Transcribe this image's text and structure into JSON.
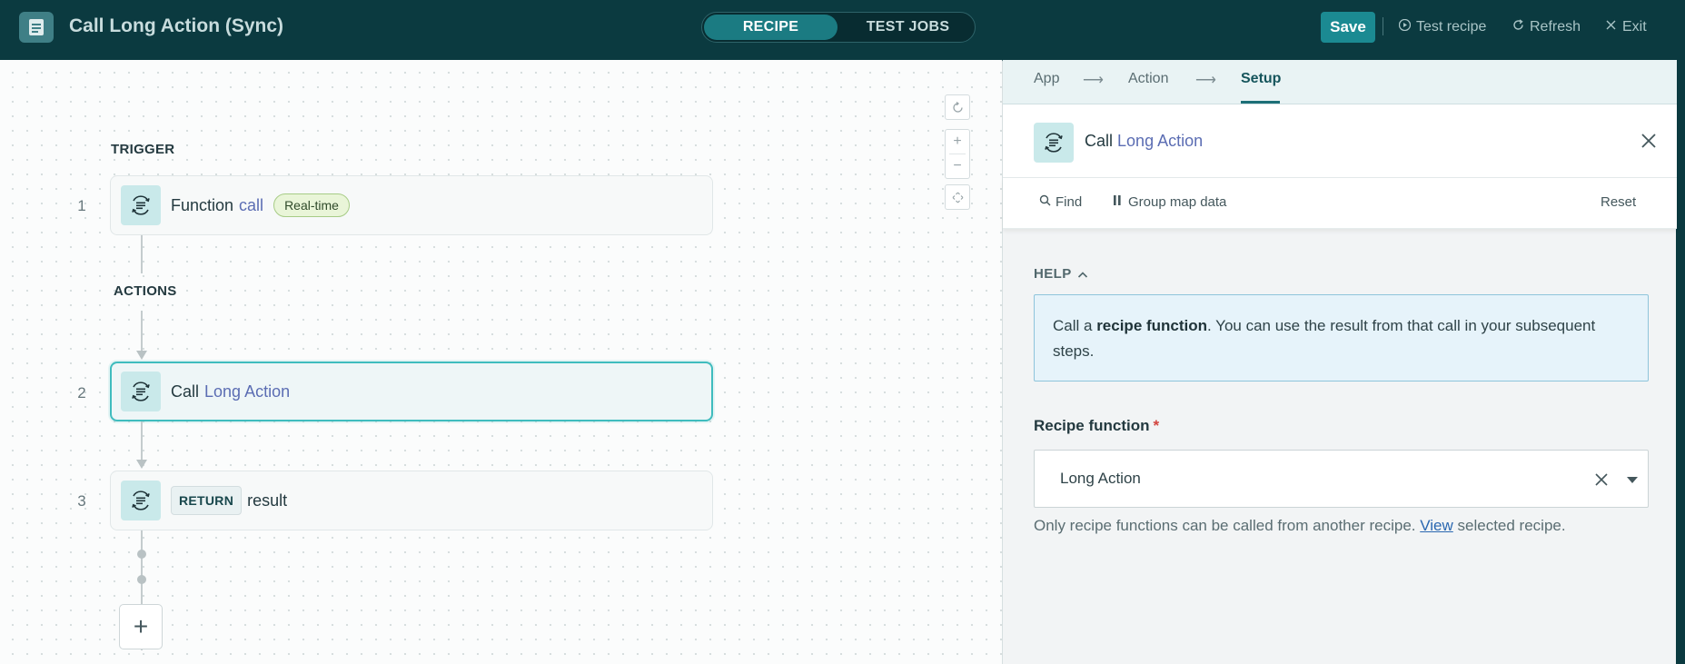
{
  "header": {
    "title": "Call Long Action (Sync)",
    "tabs": [
      "RECIPE",
      "TEST JOBS"
    ],
    "save_label": "Save",
    "test_recipe_label": "Test recipe",
    "refresh_label": "Refresh",
    "exit_label": "Exit"
  },
  "canvas": {
    "trigger_label": "TRIGGER",
    "actions_label": "ACTIONS",
    "steps": [
      {
        "number": "1",
        "text_plain": "Function",
        "text_highlight": "call",
        "badge": "Real-time"
      },
      {
        "number": "2",
        "text_plain": "Call",
        "text_highlight": "Long Action"
      },
      {
        "number": "3",
        "keyword": "RETURN",
        "text_plain": "result"
      }
    ],
    "add_step_symbol": "+"
  },
  "panel": {
    "breadcrumbs": [
      "App",
      "Action",
      "Setup"
    ],
    "breadcrumb_separator": "⟶",
    "step_title_plain": "Call",
    "step_title_highlight": "Long Action",
    "toolbar": {
      "find_label": "Find",
      "group_map_label": "Group map data",
      "reset_label": "Reset"
    },
    "help": {
      "header": "HELP",
      "text_before": "Call a ",
      "text_bold": "recipe function",
      "text_after": ". You can use the result from that call in your subsequent steps."
    },
    "field": {
      "label": "Recipe function",
      "required_mark": "*",
      "value": "Long Action",
      "hint_before": "Only recipe functions can be called from another recipe. ",
      "hint_link": "View",
      "hint_after": " selected recipe."
    }
  },
  "colors": {
    "header_bg": "#0b3a40",
    "accent": "#1b8a92",
    "highlight_text": "#5b6db3",
    "selected_border": "#3fbcbe",
    "link": "#2a67b0"
  },
  "icons": [
    "recipe-doc-icon",
    "play-icon",
    "refresh-icon",
    "close-icon",
    "reset-view-icon",
    "zoom-in-icon",
    "zoom-out-icon",
    "fit-view-icon",
    "function-icon",
    "search-icon",
    "group-map-icon",
    "chevron-up-icon",
    "clear-icon",
    "caret-down-icon"
  ]
}
